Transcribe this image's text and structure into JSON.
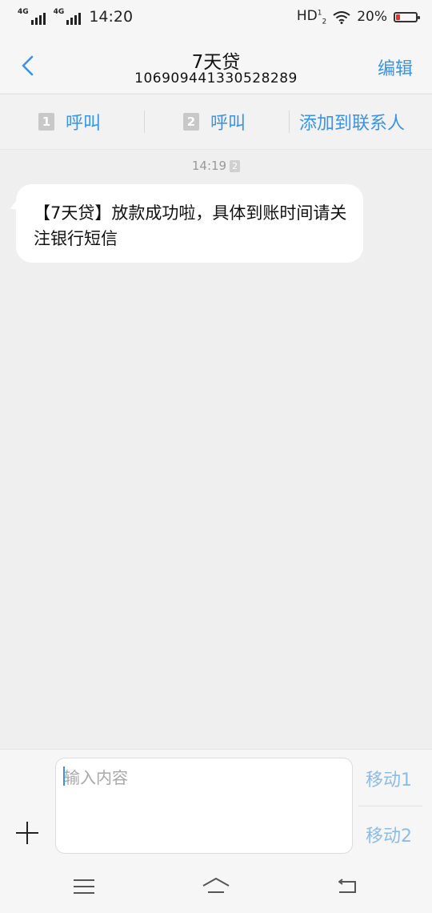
{
  "status_bar": {
    "signal1_label": "4G",
    "signal2_label": "4G",
    "time": "14:20",
    "hd_label": "HD",
    "hd_sup": "1",
    "hd_sub": "2",
    "battery_percent_text": "20%",
    "battery_level": 0.2,
    "battery_color": "#e0322f"
  },
  "header": {
    "title": "7天贷",
    "number": "106909441330528289",
    "edit_label": "编辑",
    "accent_color": "#3794e8"
  },
  "actions": {
    "call_sim1_badge": "1",
    "call_sim1_label": "呼叫",
    "call_sim2_badge": "2",
    "call_sim2_label": "呼叫",
    "add_contact_label": "添加到联系人"
  },
  "conversation": {
    "timestamp": "14:19",
    "timestamp_sim": "2",
    "messages": [
      {
        "direction": "incoming",
        "text": "【7天贷】放款成功啦，具体到账时间请关注银行短信"
      }
    ]
  },
  "composer": {
    "placeholder": "输入内容",
    "send_sim1_label": "移动1",
    "send_sim2_label": "移动2"
  },
  "icons": {
    "back": "chevron-left-icon",
    "plus": "plus-icon",
    "wifi": "wifi-icon",
    "battery": "battery-icon",
    "menu": "menu-icon",
    "home": "home-icon",
    "nav_back": "return-icon"
  }
}
